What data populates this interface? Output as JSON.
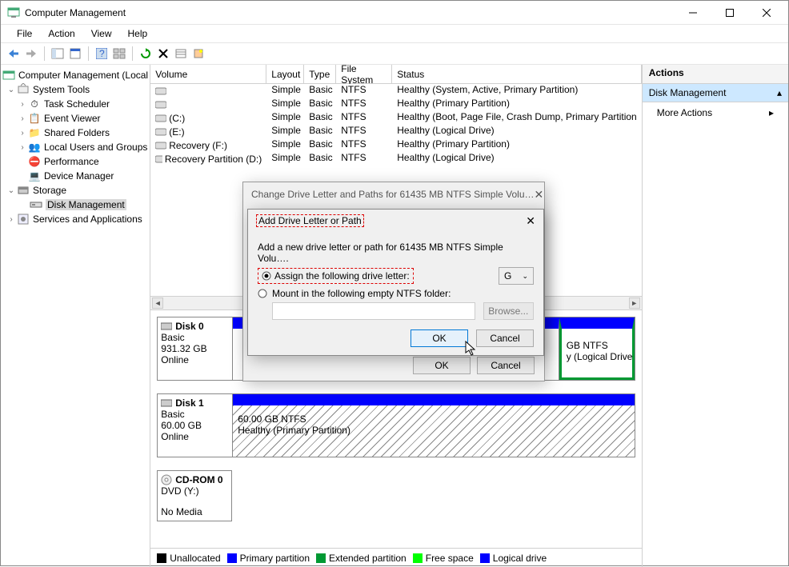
{
  "window": {
    "title": "Computer Management"
  },
  "menu": {
    "file": "File",
    "action": "Action",
    "view": "View",
    "help": "Help"
  },
  "tree": {
    "root": "Computer Management (Local",
    "sysTools": "System Tools",
    "sysToolsItems": [
      "Task Scheduler",
      "Event Viewer",
      "Shared Folders",
      "Local Users and Groups",
      "Performance",
      "Device Manager"
    ],
    "storage": "Storage",
    "diskMgmt": "Disk Management",
    "services": "Services and Applications"
  },
  "volHeaders": {
    "volume": "Volume",
    "layout": "Layout",
    "type": "Type",
    "fs": "File System",
    "status": "Status"
  },
  "volumes": [
    {
      "name": "",
      "layout": "Simple",
      "type": "Basic",
      "fs": "NTFS",
      "status": "Healthy (System, Active, Primary Partition)"
    },
    {
      "name": "",
      "layout": "Simple",
      "type": "Basic",
      "fs": "NTFS",
      "status": "Healthy (Primary Partition)"
    },
    {
      "name": "(C:)",
      "layout": "Simple",
      "type": "Basic",
      "fs": "NTFS",
      "status": "Healthy (Boot, Page File, Crash Dump, Primary Partition"
    },
    {
      "name": "(E:)",
      "layout": "Simple",
      "type": "Basic",
      "fs": "NTFS",
      "status": "Healthy (Logical Drive)"
    },
    {
      "name": "Recovery (F:)",
      "layout": "Simple",
      "type": "Basic",
      "fs": "NTFS",
      "status": "Healthy (Primary Partition)"
    },
    {
      "name": "Recovery Partition (D:)",
      "layout": "Simple",
      "type": "Basic",
      "fs": "NTFS",
      "status": "Healthy (Logical Drive)"
    }
  ],
  "disks": {
    "d0": {
      "name": "Disk 0",
      "type": "Basic",
      "size": "931.32 GB",
      "state": "Online",
      "blk1": {
        "line1": "GB NTFS",
        "line2": "y (Logical Drive"
      }
    },
    "d1": {
      "name": "Disk 1",
      "type": "Basic",
      "size": "60.00 GB",
      "state": "Online",
      "blk": {
        "line1": "60.00 GB NTFS",
        "line2": "Healthy (Primary Partition)"
      }
    },
    "cd": {
      "name": "CD-ROM 0",
      "type": "DVD (Y:)",
      "noMedia": "No Media"
    }
  },
  "legend": {
    "unallocated": "Unallocated",
    "primary": "Primary partition",
    "extended": "Extended partition",
    "free": "Free space",
    "logical": "Logical drive"
  },
  "actions": {
    "header": "Actions",
    "diskMgmt": "Disk Management",
    "more": "More Actions"
  },
  "dialog1": {
    "title": "Change Drive Letter and Paths for 61435 MB NTFS Simple Volu…",
    "ok": "OK",
    "cancel": "Cancel"
  },
  "dialog2": {
    "title": "Add Drive Letter or Path",
    "desc": "Add a new drive letter or path for 61435 MB NTFS Simple Volu….",
    "radio1": "Assign the following drive letter:",
    "radio2": "Mount in the following empty NTFS folder:",
    "driveLetter": "G",
    "browse": "Browse...",
    "ok": "OK",
    "cancel": "Cancel"
  }
}
